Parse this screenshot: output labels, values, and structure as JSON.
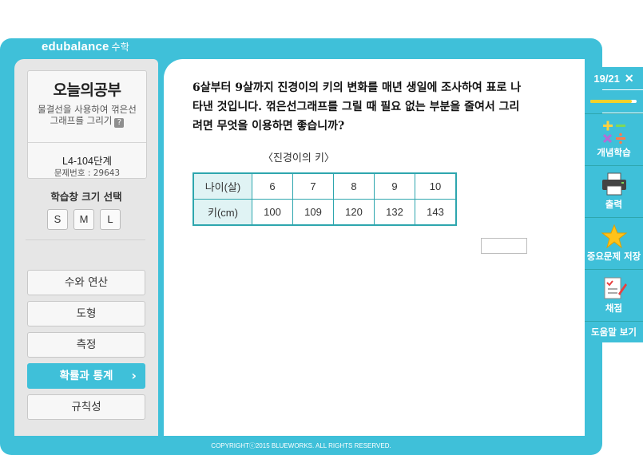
{
  "brand": {
    "name": "edubalance",
    "sub": "수학"
  },
  "lesson": {
    "heading": "오늘의공부",
    "topic": "물결선을 사용하여 꺾은선 그래프를 그리기",
    "help": "?",
    "level": "L4-104단계",
    "problem_no": "문제번호 : 29643"
  },
  "size_select": {
    "label": "학습창 크기 선택",
    "options": [
      "S",
      "M",
      "L"
    ]
  },
  "menu": [
    {
      "label": "수와 연산"
    },
    {
      "label": "도형"
    },
    {
      "label": "측정"
    },
    {
      "label": "확률과 통계",
      "active": true,
      "chevron": "›"
    },
    {
      "label": "규칙성"
    }
  ],
  "question": {
    "text": "6살부터 9살까지 진경이의 키의 변화를 매년 생일에 조사하여 표로 나타낸 것입니다. 꺾은선그래프를 그릴 때 필요 없는 부분을 줄여서 그리려면 무엇을 이용하면 좋습니까?",
    "table_caption": "〈진경이의  키〉",
    "table": {
      "rows": [
        {
          "header": "나이(살)",
          "cells": [
            "6",
            "7",
            "8",
            "9",
            "10"
          ]
        },
        {
          "header": "키(cm)",
          "cells": [
            "100",
            "109",
            "120",
            "132",
            "143"
          ]
        }
      ]
    },
    "answer_value": ""
  },
  "pager": {
    "current": "19/21",
    "close": "✕",
    "progress_fraction": 0.9
  },
  "right_menu": [
    {
      "label": "개념학습",
      "icon": "math-operations-icon"
    },
    {
      "label": "출력",
      "icon": "printer-icon"
    },
    {
      "label": "중요문제 저장",
      "icon": "star-icon"
    },
    {
      "label": "채점",
      "icon": "grading-icon"
    },
    {
      "label": "도움말 보기"
    }
  ],
  "footer": {
    "copyright": "COPYRIGHTⓒ2015 BLUEWORKS. ALL RIGHTS RESERVED."
  },
  "colors": {
    "accent": "#3fc0d9",
    "table_border": "#2ea6ae",
    "progress": "#f0d12a"
  }
}
